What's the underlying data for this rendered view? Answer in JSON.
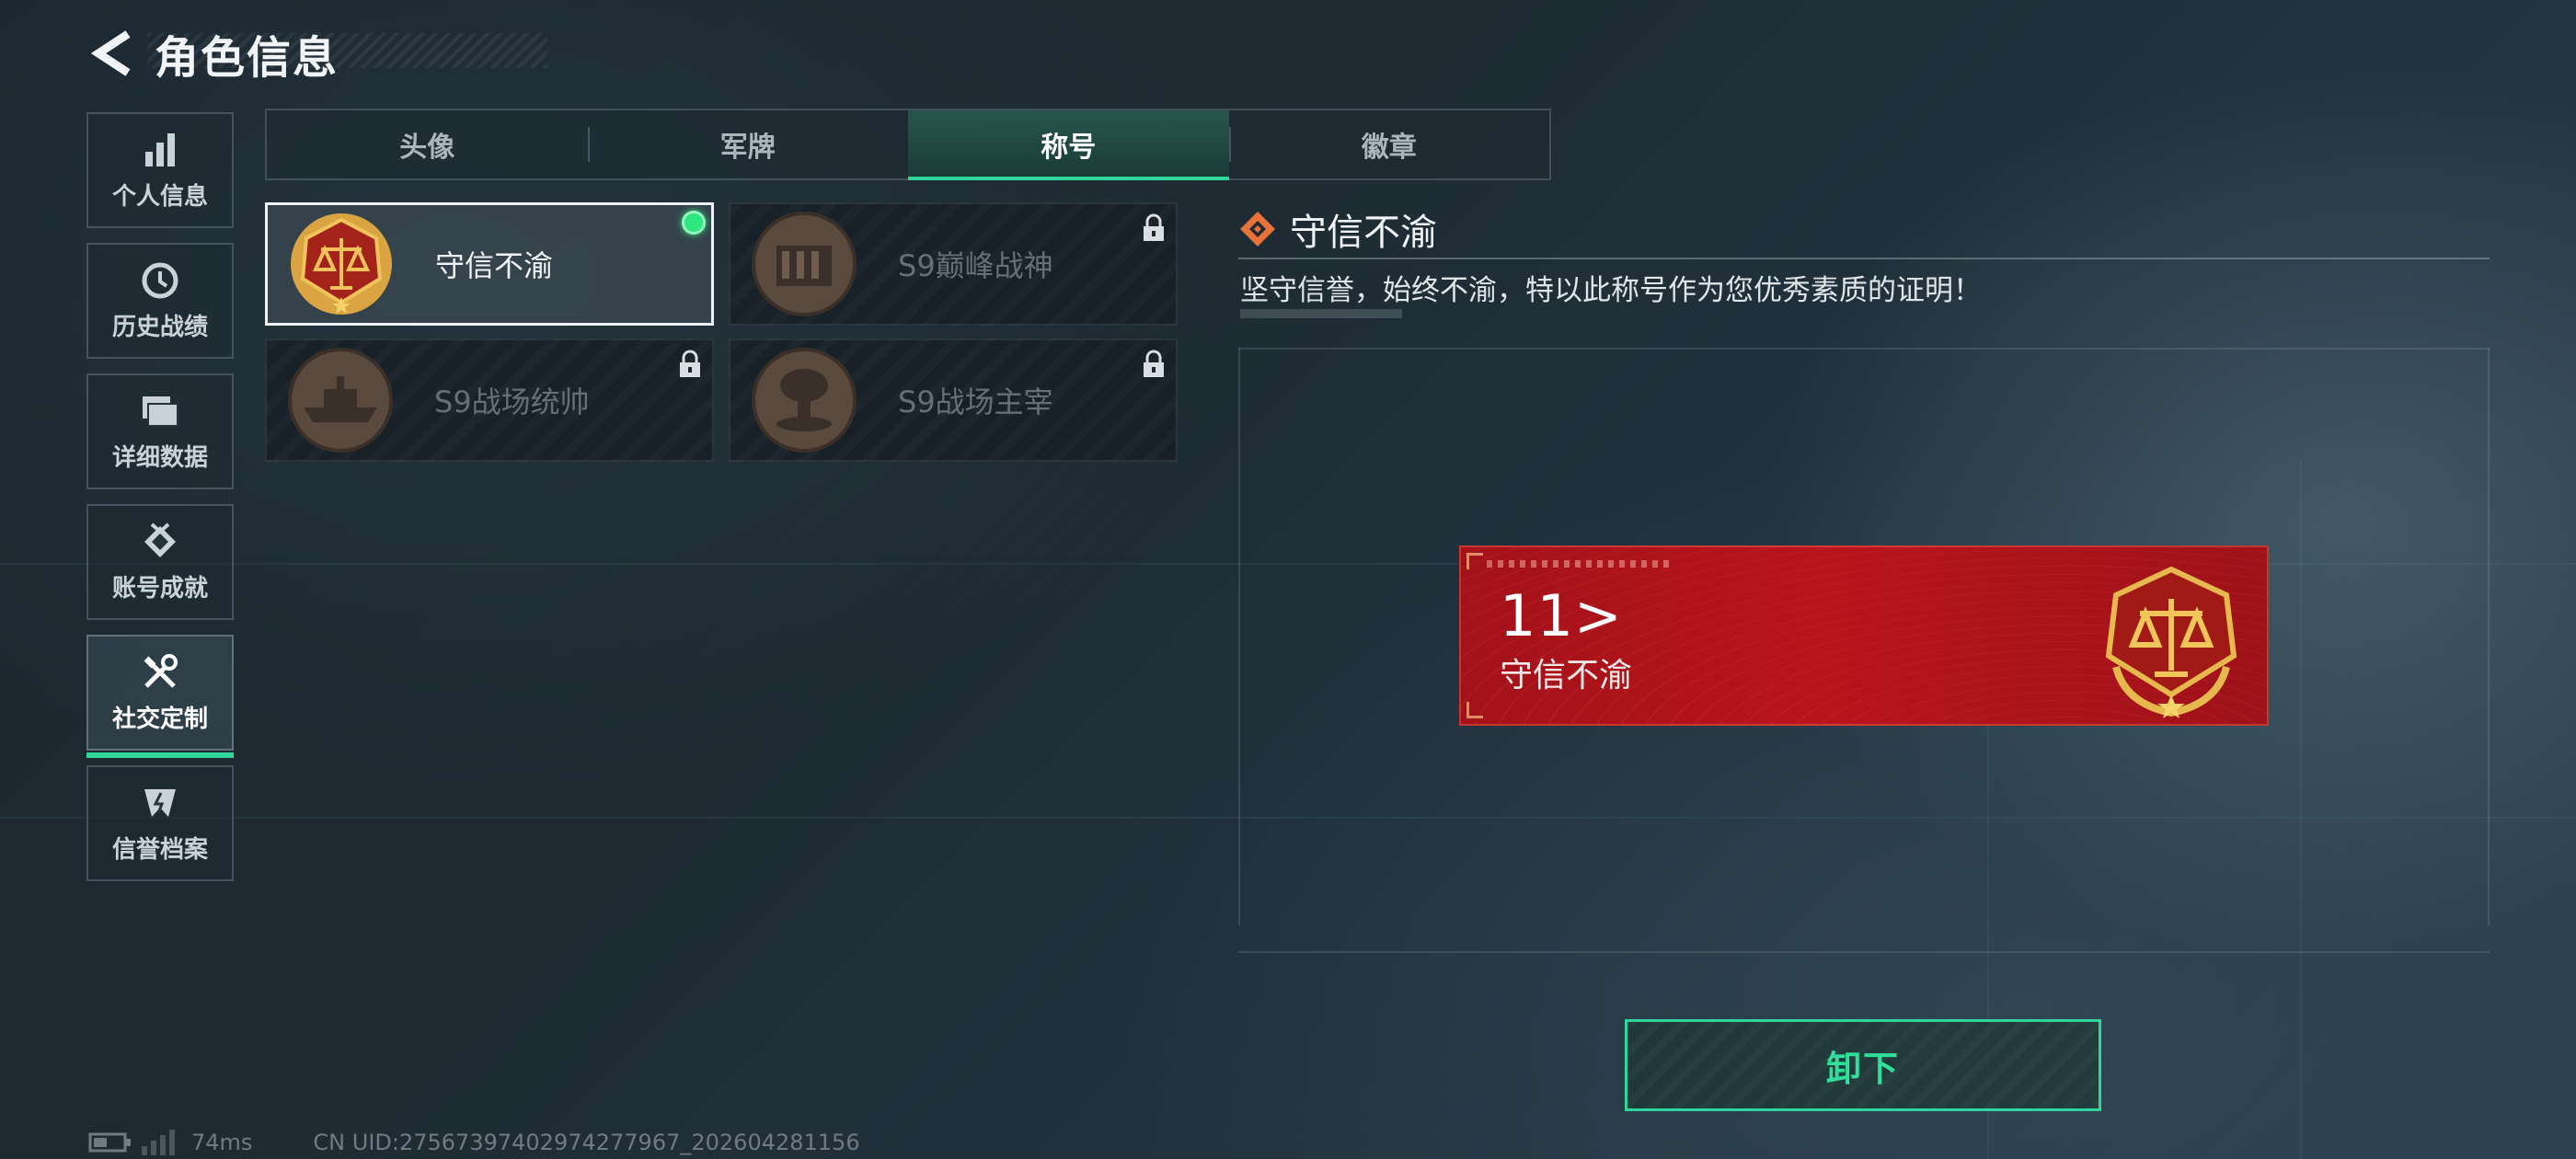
{
  "header": {
    "title": "角色信息"
  },
  "sidebar": {
    "items": [
      {
        "label": "个人信息",
        "icon": "bar-chart-icon"
      },
      {
        "label": "历史战绩",
        "icon": "history-icon"
      },
      {
        "label": "详细数据",
        "icon": "folder-icon"
      },
      {
        "label": "账号成就",
        "icon": "achievement-icon"
      },
      {
        "label": "社交定制",
        "icon": "tools-icon",
        "active": true
      },
      {
        "label": "信誉档案",
        "icon": "shield-icon"
      }
    ]
  },
  "tabs": [
    {
      "label": "头像"
    },
    {
      "label": "军牌"
    },
    {
      "label": "称号",
      "active": true
    },
    {
      "label": "徽章"
    }
  ],
  "titles": [
    {
      "name": "守信不渝",
      "selected": true,
      "equipped": true,
      "locked": false,
      "icon": "scales-medal-icon"
    },
    {
      "name": "S9巅峰战神",
      "locked": true,
      "icon": "fortress-medal-icon"
    },
    {
      "name": "S9战场统帅",
      "locked": true,
      "icon": "ship-medal-icon"
    },
    {
      "name": "S9战场主宰",
      "locked": true,
      "icon": "mushroom-cloud-medal-icon"
    }
  ],
  "detail": {
    "title": "守信不渝",
    "description": "坚守信誉，始终不渝，特以此称号作为您优秀素质的证明！"
  },
  "banner": {
    "number": "11>",
    "title": "守信不渝"
  },
  "actions": {
    "unequip": "卸下"
  },
  "footer": {
    "ping": "74ms",
    "uid": "CN UID:275673974029742779​67_202604281156"
  },
  "colors": {
    "accent": "#2fd59a",
    "banner": "#b8141c",
    "equipped_dot": "#2ee87e"
  }
}
